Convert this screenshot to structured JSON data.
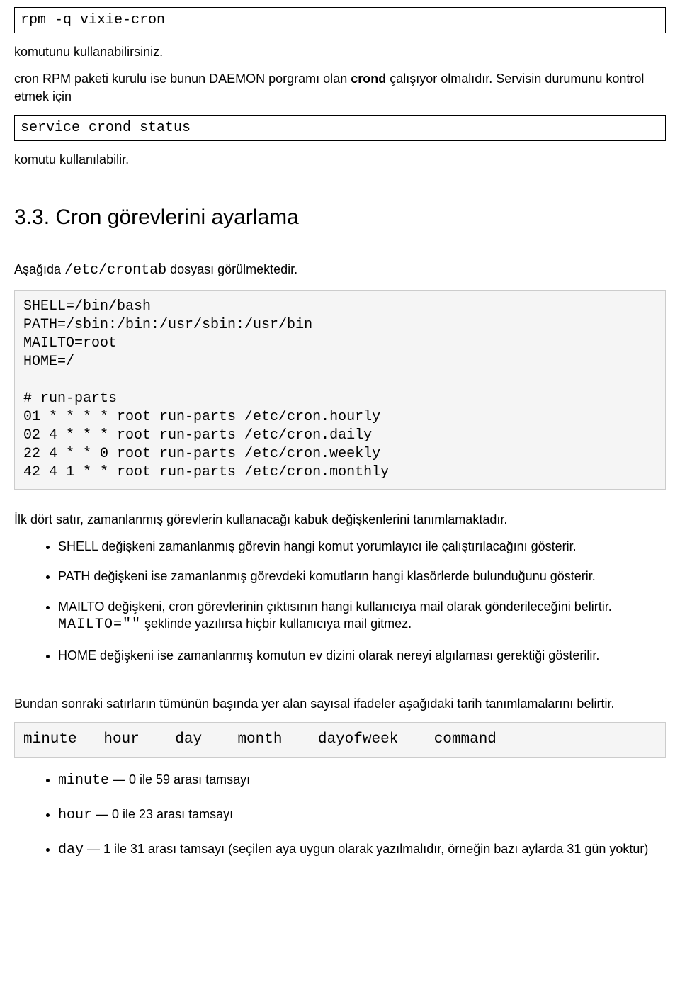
{
  "cmd1": "rpm -q vixie-cron",
  "p1": "komutunu kullanabilirsiniz.",
  "p2_a": "cron RPM paketi kurulu ise bunun DAEMON porgramı olan ",
  "p2_b": "crond",
  "p2_c": " çalışıyor olmalıdır. Servisin durumunu kontrol etmek için",
  "cmd2": "service crond status",
  "p3": "komutu kullanılabilir.",
  "heading": "3.3. Cron görevlerini ayarlama",
  "p4_a": "Aşağıda ",
  "p4_code": "/etc/crontab",
  "p4_b": " dosyası görülmektedir.",
  "crontab": "SHELL=/bin/bash\nPATH=/sbin:/bin:/usr/sbin:/usr/bin\nMAILTO=root\nHOME=/\n\n# run-parts\n01 * * * * root run-parts /etc/cron.hourly\n02 4 * * * root run-parts /etc/cron.daily\n22 4 * * 0 root run-parts /etc/cron.weekly\n42 4 1 * * root run-parts /etc/cron.monthly",
  "p5": "İlk dört satır, zamanlanmış görevlerin kullanacağı kabuk değişkenlerini tanımlamaktadır.",
  "bullets1": [
    "SHELL değişkeni zamanlanmış görevin hangi komut yorumlayıcı ile çalıştırılacağını gösterir.",
    "PATH değişkeni ise zamanlanmış görevdeki komutların hangi klasörlerde bulunduğunu gösterir."
  ],
  "bullet_mailto_a": "MAILTO değişkeni, cron görevlerinin çıktısının hangi kullanıcıya mail olarak gönderileceğini belirtir. ",
  "bullet_mailto_code": "MAILTO=\"\"",
  "bullet_mailto_b": " şeklinde yazılırsa hiçbir kullanıcıya mail gitmez.",
  "bullet_home": "HOME değişkeni ise zamanlanmış komutun ev dizini olarak nereyi algılaması gerektiği gösterilir.",
  "p6": "Bundan sonraki satırların tümünün başında yer alan sayısal ifadeler aşağıdaki tarih tanımlamalarını belirtir.",
  "fields": "minute   hour    day    month    dayofweek    command",
  "field_items": [
    {
      "code": "minute",
      "text": " — 0 ile 59 arası tamsayı"
    },
    {
      "code": "hour",
      "text": " — 0 ile 23 arası tamsayı"
    },
    {
      "code": "day",
      "text": " — 1 ile 31 arası tamsayı (seçilen aya uygun olarak yazılmalıdır, örneğin bazı aylarda 31 gün yoktur)"
    }
  ]
}
